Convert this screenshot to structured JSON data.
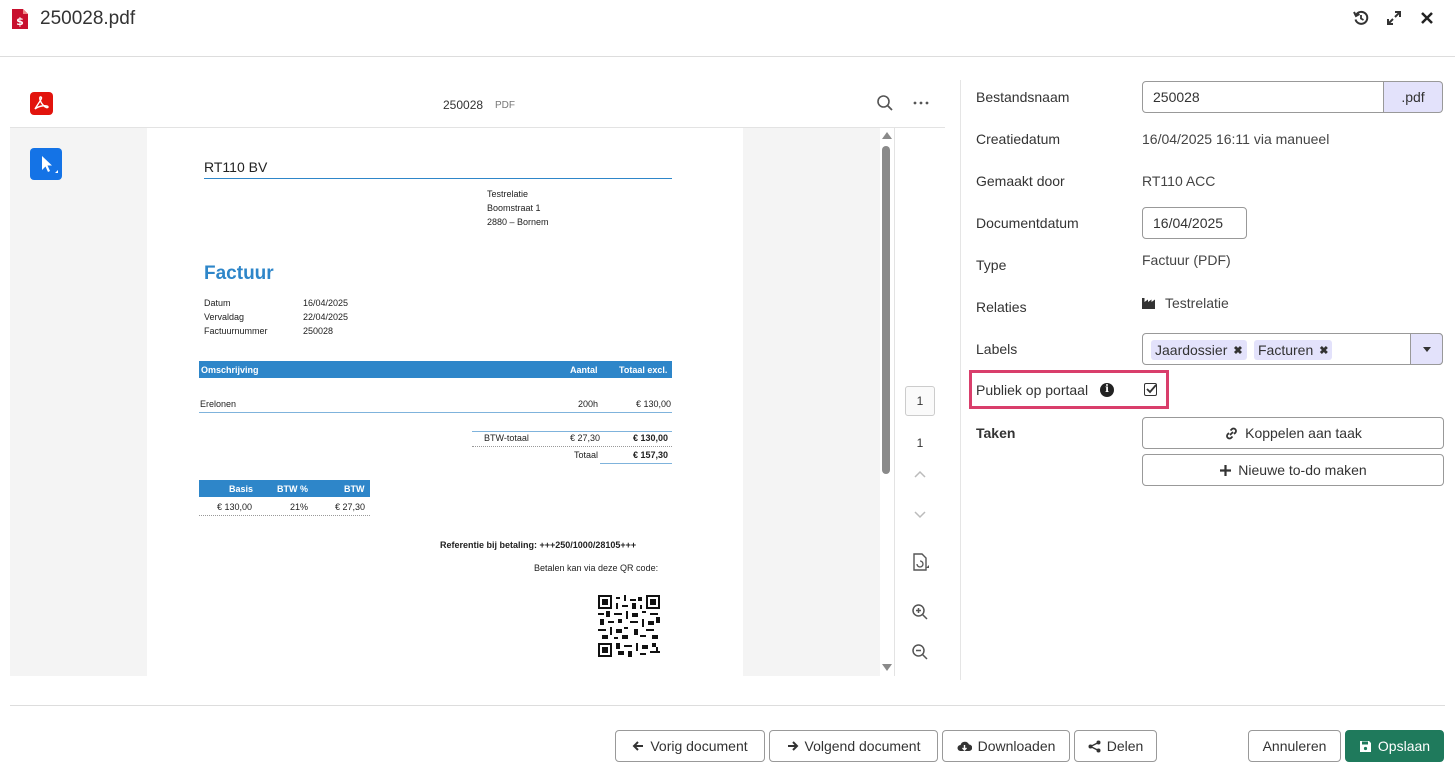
{
  "header": {
    "title": "250028.pdf",
    "file_icon": "pdf-dollar-file-icon",
    "history_icon": "history-icon",
    "expand_icon": "expand-icon",
    "close_icon": "close-icon"
  },
  "viewer": {
    "file_name": "250028",
    "file_ext": "PDF",
    "current_page": "1",
    "total_pages": "1"
  },
  "invoice": {
    "company": "RT110 BV",
    "address": [
      "Testrelatie",
      "Boomstraat 1",
      "2880 – Bornem"
    ],
    "title": "Factuur",
    "meta": [
      {
        "label": "Datum",
        "value": "16/04/2025"
      },
      {
        "label": "Vervaldag",
        "value": "22/04/2025"
      },
      {
        "label": "Factuurnummer",
        "value": "250028"
      }
    ],
    "table_headers": {
      "description": "Omschrijving",
      "qty": "Aantal",
      "total": "Totaal excl."
    },
    "line": {
      "description": "Erelonen",
      "qty": "200h",
      "total": "€ 130,00"
    },
    "btw_total": {
      "label": "BTW-totaal",
      "vat": "€ 27,30",
      "amount": "€ 130,00"
    },
    "total": {
      "label": "Totaal",
      "amount": "€ 157,30"
    },
    "btw_headers": {
      "basis": "Basis",
      "pct": "BTW %",
      "btw": "BTW"
    },
    "btw_row": {
      "basis": "€ 130,00",
      "pct": "21%",
      "btw": "€ 27,30"
    },
    "reference": "Referentie bij betaling: +++250/1000/28105+++",
    "qr_note": "Betalen kan via deze QR code:"
  },
  "form": {
    "filename_label": "Bestandsnaam",
    "filename_value": "250028",
    "filename_ext": ".pdf",
    "created_label": "Creatiedatum",
    "created_value": "16/04/2025 16:11 via manueel",
    "author_label": "Gemaakt door",
    "author_value": "RT110 ACC",
    "docdate_label": "Documentdatum",
    "docdate_value": "16/04/2025",
    "type_label": "Type",
    "type_value": "Factuur (PDF)",
    "relations_label": "Relaties",
    "relations_value": "Testrelatie",
    "labels_label": "Labels",
    "tags": [
      "Jaardossier",
      "Facturen"
    ],
    "public_label": "Publiek op portaal",
    "public_checked": true,
    "tasks_label": "Taken",
    "link_task": "Koppelen aan taak",
    "new_todo": "Nieuwe to-do maken"
  },
  "footer": {
    "prev": "Vorig document",
    "next": "Volgend document",
    "download": "Downloaden",
    "share": "Delen",
    "cancel": "Annuleren",
    "save": "Opslaan"
  },
  "colors": {
    "accent": "#2e86c9",
    "highlight": "#d93e6b",
    "save": "#1f7a5c",
    "tag_bg": "#e3e2fb"
  }
}
